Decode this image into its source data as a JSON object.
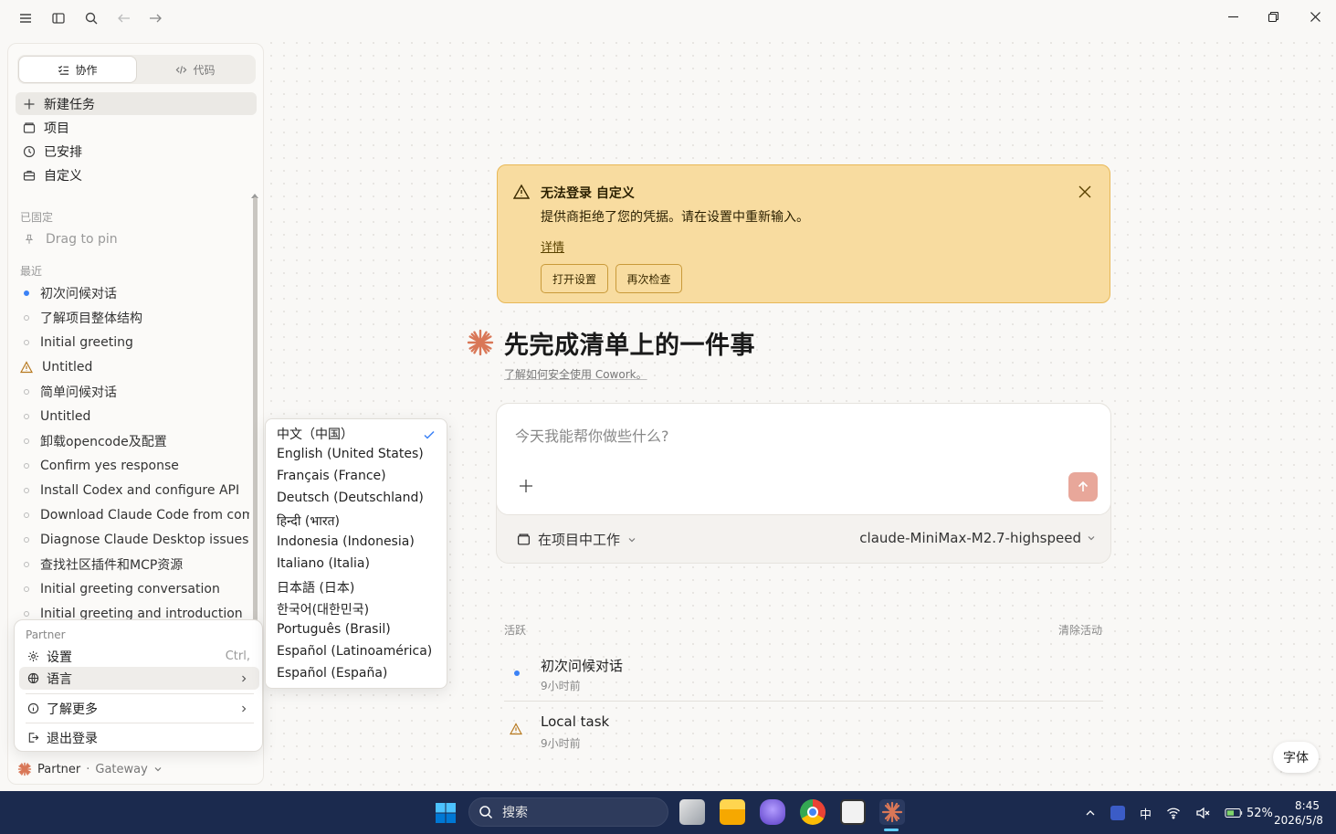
{
  "colors": {
    "accent": "#d97757",
    "alert_bg": "#f8dca0",
    "alert_border": "#e8b857",
    "taskbar": "#1b2a4e",
    "check": "#3b82f6"
  },
  "titlebar": {
    "icons": [
      "menu-icon",
      "sidebar-toggle-icon",
      "search-icon",
      "back-arrow-icon",
      "forward-arrow-icon"
    ]
  },
  "sidebar": {
    "mode_tabs": [
      {
        "label": "协作",
        "icon": "cowork-icon"
      },
      {
        "label": "代码",
        "icon": "code-icon"
      }
    ],
    "nav": [
      {
        "label": "新建任务",
        "icon": "plus-icon"
      },
      {
        "label": "项目",
        "icon": "folder-icon"
      },
      {
        "label": "已安排",
        "icon": "clock-icon"
      },
      {
        "label": "自定义",
        "icon": "briefcase-icon"
      }
    ],
    "pinned_label": "已固定",
    "drag_to_pin": "Drag to pin",
    "recent_label": "最近",
    "recent": [
      {
        "label": "初次问候对话",
        "status": "active"
      },
      {
        "label": "了解项目整体结构",
        "status": "idle"
      },
      {
        "label": "Initial greeting",
        "status": "idle"
      },
      {
        "label": "Untitled",
        "status": "warning"
      },
      {
        "label": "简单问候对话",
        "status": "idle"
      },
      {
        "label": "Untitled",
        "status": "idle"
      },
      {
        "label": "卸载opencode及配置",
        "status": "idle"
      },
      {
        "label": "Confirm yes response",
        "status": "idle"
      },
      {
        "label": "Install Codex and configure API",
        "status": "idle"
      },
      {
        "label": "Download Claude Code from comm",
        "status": "idle"
      },
      {
        "label": "Diagnose Claude Desktop issues",
        "status": "idle"
      },
      {
        "label": "查找社区插件和MCP资源",
        "status": "idle"
      },
      {
        "label": "Initial greeting conversation",
        "status": "idle"
      },
      {
        "label": "Initial greeting and introduction",
        "status": "idle"
      }
    ],
    "user": {
      "name": "Partner",
      "separator": "·",
      "org": "Gateway"
    }
  },
  "context_menu": {
    "header": "Partner",
    "items": [
      {
        "label": "设置",
        "icon": "gear-icon",
        "shortcut": "Ctrl,"
      },
      {
        "label": "语言",
        "icon": "globe-icon",
        "submenu": true
      },
      {
        "label": "了解更多",
        "icon": "info-icon",
        "submenu": true
      },
      {
        "label": "退出登录",
        "icon": "logout-icon"
      }
    ]
  },
  "language_menu": {
    "selected": "中文（中国）",
    "items": [
      "中文（中国）",
      "English (United States)",
      "Français (France)",
      "Deutsch (Deutschland)",
      "हिन्दी (भारत)",
      "Indonesia (Indonesia)",
      "Italiano (Italia)",
      "日本語 (日本)",
      "한국어(대한민국)",
      "Português (Brasil)",
      "Español (Latinoamérica)",
      "Español (España)"
    ]
  },
  "alert": {
    "title": "无法登录 自定义",
    "message": "提供商拒绝了您的凭据。请在设置中重新输入。",
    "details": "详情",
    "buttons": [
      "打开设置",
      "再次检查"
    ]
  },
  "main": {
    "title": "先完成清单上的一件事",
    "subtitle": "了解如何安全使用 Cowork。",
    "input_placeholder": "今天我能帮你做些什么?",
    "project_button": "在项目中工作",
    "model": "claude-MiniMax-M2.7-highspeed"
  },
  "activity": {
    "label": "活跃",
    "clear": "清除活动",
    "items": [
      {
        "title": "初次问候对话",
        "time": "9小时前",
        "status": "active"
      },
      {
        "title": "Local task",
        "time": "9小时前",
        "status": "warning"
      }
    ]
  },
  "font_button": "字体",
  "taskbar": {
    "search": "搜索",
    "apps": [
      "file-manager-icon",
      "explorer-icon",
      "obsidian-icon",
      "chrome-icon",
      "terminal-icon",
      "claude-icon"
    ],
    "tray": {
      "ime": "中",
      "battery": "52%"
    },
    "clock": {
      "time": "8:45",
      "date": "2026/5/8"
    }
  }
}
